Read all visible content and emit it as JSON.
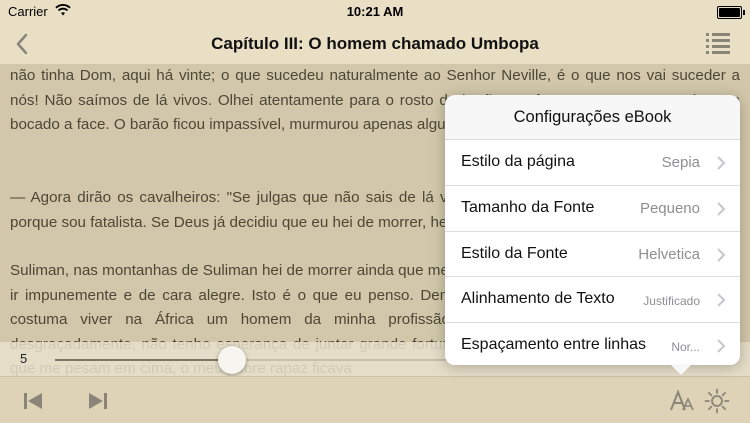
{
  "status": {
    "carrier": "Carrier",
    "time": "10:21 AM"
  },
  "nav": {
    "title": "Capítulo III: O homem chamado Umbopa"
  },
  "content": {
    "paragraphs": [
      "não tinha Dom, aqui há vinte; o que sucedeu naturalmente ao Senhor Neville, é o que nos vai suceder a nós! Não saímos de lá vivos. Olhei atentamente para o rosto do barão; confesso que se me arrepiou um bocado a face. O barão ficou impassível, murmurou apenas algumas palavras. Eu prossegui:",
      "— Agora dirão os cavalheiros: \"Se julgas que não sais de lá vivo, porque vais?\" Vou, em primeiro lugar, porque sou fatalista. Se Deus já decidiu que eu hei de morrer, hei de morrer.",
      "Suliman, nas montanhas de Suliman hei de morrer ainda que me recuse a partir. Se for o contrário, posso lá ir impunemente e de cara alegre. Isto é o que eu penso. Demais, já tenho vivi três vezes mais do que costuma viver na África um homem da minha profissão, e se continuando nesta carreira, e desgraçadamente, não tenho esperança de juntar grande fortuna. Ora se morresse agora com as dívidas que me pesam em cima, o meu pobre rapaz ficava"
    ]
  },
  "slider": {
    "page": "5",
    "progress": 0.26
  },
  "popover": {
    "title": "Configurações eBook",
    "rows": [
      {
        "label": "Estilo da página",
        "value": "Sepia"
      },
      {
        "label": "Tamanho da Fonte",
        "value": "Pequeno"
      },
      {
        "label": "Estilo da Fonte",
        "value": "Helvetica"
      },
      {
        "label": "Alinhamento de Texto",
        "value": "Justificado"
      },
      {
        "label": "Espaçamento entre linhas",
        "value": "Nor..."
      }
    ]
  },
  "colors": {
    "sepia": "#ded3b6",
    "text": "#4a4535"
  },
  "icons": [
    "wifi-icon",
    "battery-icon",
    "back-chevron-icon",
    "toc-list-icon",
    "skip-previous-icon",
    "skip-next-icon",
    "font-size-icon",
    "brightness-icon",
    "chevron-right-icon"
  ]
}
